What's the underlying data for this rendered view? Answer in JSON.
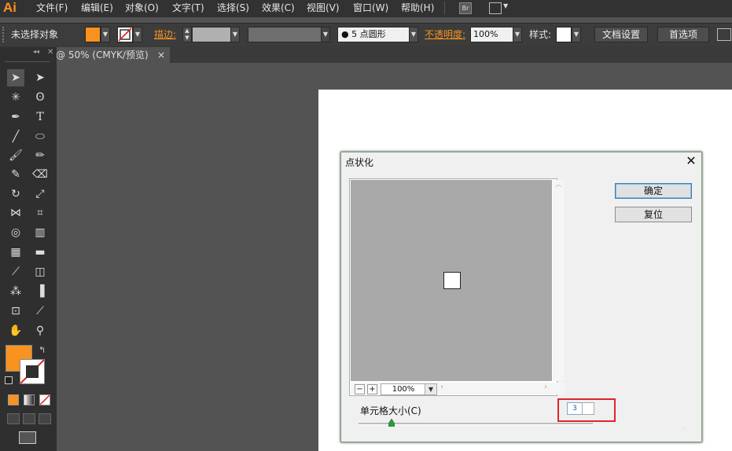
{
  "menubar": {
    "logo": "Ai",
    "items": [
      "文件(F)",
      "编辑(E)",
      "对象(O)",
      "文字(T)",
      "选择(S)",
      "效果(C)",
      "视图(V)",
      "窗口(W)",
      "帮助(H)"
    ],
    "bridge_label": "Br"
  },
  "control": {
    "selection_status": "未选择对象",
    "fill_color": "#f7931e",
    "stroke_label": "描边:",
    "brush_label": "5 点圆形",
    "opacity_label": "不透明度:",
    "opacity_value": "100%",
    "style_label": "样式:",
    "doc_setup_button": "文档设置",
    "prefs_button": "首选项"
  },
  "document_tab": {
    "label": "@ 50% (CMYK/预览)",
    "close": "×"
  },
  "tools": {
    "fill_color": "#f7931e"
  },
  "dialog": {
    "title": "点状化",
    "close": "✕",
    "ok_button": "确定",
    "reset_button": "复位",
    "zoom_value": "100%",
    "cell_size_label": "单元格大小(C)",
    "cell_size_value": "3",
    "slider_value": 0.14,
    "zoom_minus": "−",
    "zoom_plus": "+"
  }
}
